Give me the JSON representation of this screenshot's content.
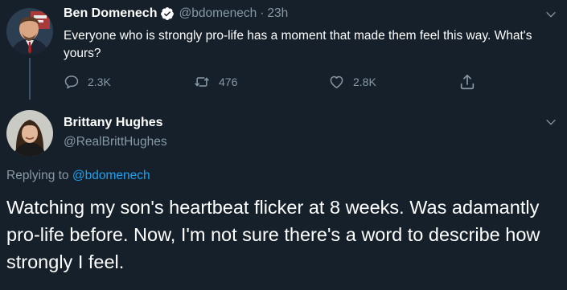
{
  "tweet_parent": {
    "author_name": "Ben Domenech",
    "handle": "@bdomenech",
    "separator": "·",
    "time": "23h",
    "text": "Everyone who is strongly pro-life has a moment that made them feel this way. What's yours?",
    "replies": "2.3K",
    "retweets": "476",
    "likes": "2.8K"
  },
  "tweet_reply": {
    "author_name": "Brittany Hughes",
    "handle": "@RealBrittHughes",
    "replying_prefix": "Replying to",
    "replying_to": "@bdomenech",
    "text": "Watching my son's heartbeat flicker at 8 weeks. Was adamantly pro-life before. Now, I'm not sure there's a word to describe how strongly I feel."
  },
  "colors": {
    "background": "#15202b",
    "muted": "#8899a6",
    "link": "#1da1f2",
    "verified": "#ffffff"
  },
  "icons": {
    "reply": "reply-icon",
    "retweet": "retweet-icon",
    "like": "heart-icon",
    "share": "share-icon",
    "verified": "verified-badge-icon",
    "menu": "chevron-down-icon"
  }
}
